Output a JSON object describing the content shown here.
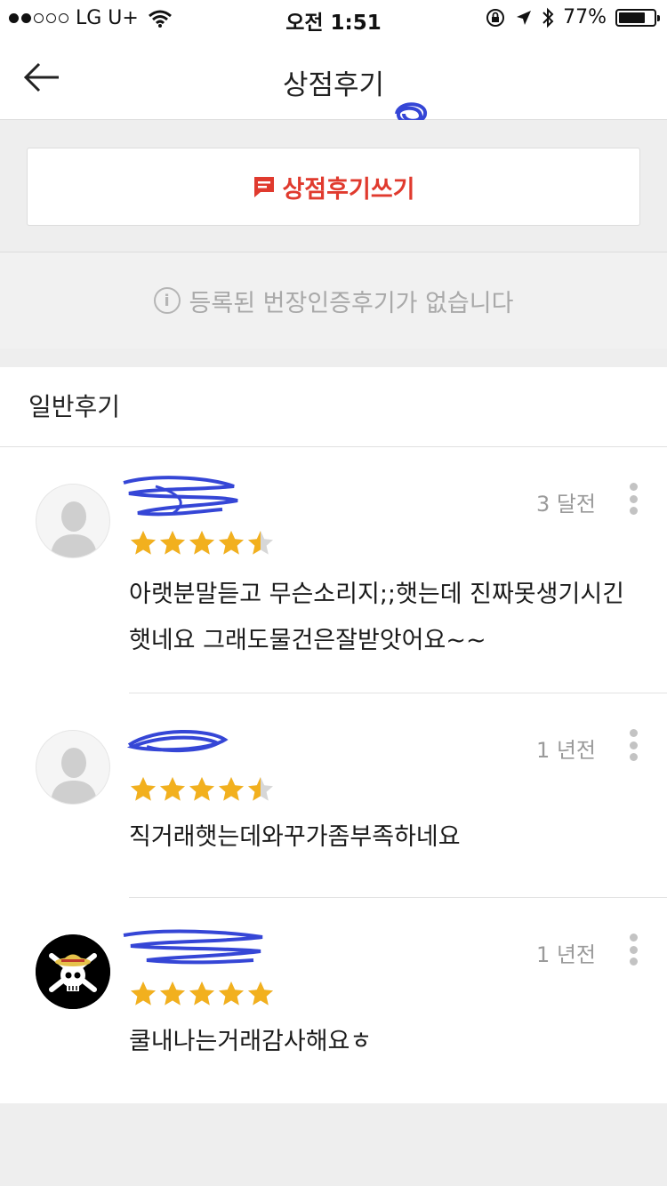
{
  "status_bar": {
    "carrier": "LG U+",
    "time": "오전 1:51",
    "battery": "77%",
    "battery_level": 0.77
  },
  "nav": {
    "title": "상점후기"
  },
  "write_review": {
    "label": "상점후기쓰기",
    "accent_color": "#e03a2e"
  },
  "notice": {
    "text": "등록된 번장인증후기가 없습니다"
  },
  "section": {
    "title": "일반후기"
  },
  "reviews": [
    {
      "time": "3 달전",
      "rating": 4.5,
      "text": "아랫분말듣고 무슨소리지;;햇는데 진짜못생기시긴햇네요 그래도물건은잘받앗어요~~",
      "avatar": "default-profile-icon"
    },
    {
      "time": "1 년전",
      "rating": 4.5,
      "text": "직거래햇는데와꾸가좀부족하네요",
      "avatar": "default-profile-icon"
    },
    {
      "time": "1 년전",
      "rating": 5,
      "text": "쿨내나는거래감사해요ㅎ",
      "avatar": "pirate-skull-icon"
    }
  ]
}
